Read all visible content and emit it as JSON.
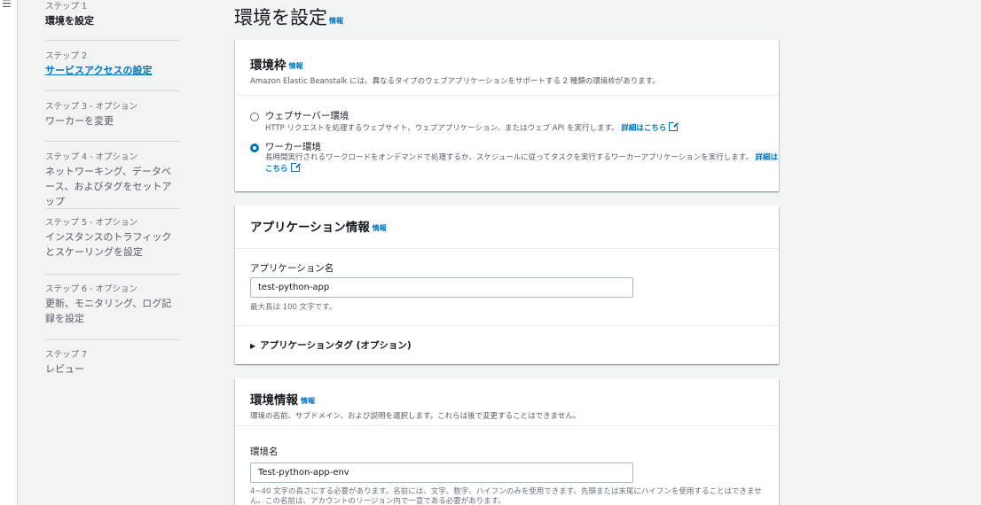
{
  "nav": {
    "steps": [
      {
        "label": "ステップ 1",
        "title": "環境を設定",
        "state": "current"
      },
      {
        "label": "ステップ 2",
        "title": "サービスアクセスの設定",
        "state": "link"
      },
      {
        "label": "ステップ 3 - オプション",
        "title": "ワーカーを変更",
        "state": "normal"
      },
      {
        "label": "ステップ 4 - オプション",
        "title": "ネットワーキング、データベース、およびタグをセットアップ",
        "state": "normal"
      },
      {
        "label": "ステップ 5 - オプション",
        "title": "インスタンスのトラフィックとスケーリングを設定",
        "state": "normal"
      },
      {
        "label": "ステップ 6 - オプション",
        "title": "更新、モニタリング、ログ記録を設定",
        "state": "normal"
      },
      {
        "label": "ステップ 7",
        "title": "レビュー",
        "state": "normal"
      }
    ]
  },
  "page": {
    "title": "環境を設定",
    "info": "情報"
  },
  "tier": {
    "title": "環境枠",
    "info": "情報",
    "desc": "Amazon Elastic Beanstalk には、異なるタイプのウェブアプリケーションをサポートする 2 種類の環境枠があります。",
    "options": [
      {
        "label": "ウェブサーバー環境",
        "desc": "HTTP リクエストを処理するウェブサイト、ウェブアプリケーション、またはウェブ API を実行します。",
        "link": "詳細はこちら",
        "checked": false
      },
      {
        "label": "ワーカー環境",
        "desc": "長時間実行されるワークロードをオンデマンドで処理するか、スケジュールに従ってタスクを実行するワーカーアプリケーションを実行します。",
        "link": "詳細はこちら",
        "checked": true
      }
    ]
  },
  "app": {
    "title": "アプリケーション情報",
    "info": "情報",
    "name_label": "アプリケーション名",
    "name_value": "test-python-app",
    "name_hint": "最大長は 100 文字です。",
    "tags_label": "アプリケーションタグ (オプション)"
  },
  "env": {
    "title": "環境情報",
    "info": "情報",
    "desc": "環境の名前、サブドメイン、および説明を選択します。これらは後で変更することはできません。",
    "name_label": "環境名",
    "name_value": "Test-python-app-env",
    "name_hint": "4~40 文字の長さにする必要があります。名前には、文字、数字、ハイフンのみを使用できます。先頭または末尾にハイフンを使用することはできません。この名前は、アカウントのリージョン内で一意である必要があります。"
  }
}
